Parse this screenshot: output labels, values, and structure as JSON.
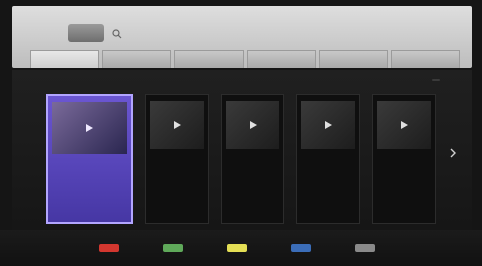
{
  "header": {
    "logo": "",
    "title": "",
    "tabs": [
      {
        "label": "",
        "active": true
      },
      {
        "label": "",
        "active": false
      },
      {
        "label": "",
        "active": false
      },
      {
        "label": "",
        "active": false
      },
      {
        "label": "",
        "active": false
      },
      {
        "label": "",
        "active": false
      }
    ]
  },
  "main": {
    "section_title": "",
    "page_indicator": "",
    "cards": [
      {
        "title": "",
        "description": "",
        "selected": true
      },
      {
        "title": "",
        "description": "",
        "selected": false
      },
      {
        "title": "",
        "description": "",
        "selected": false
      },
      {
        "title": "",
        "description": "",
        "selected": false
      },
      {
        "title": "",
        "description": "",
        "selected": false
      }
    ]
  },
  "footer": {
    "keys": [
      {
        "color": "#d3372f",
        "label": ""
      },
      {
        "color": "#5fa95a",
        "label": ""
      },
      {
        "color": "#e4df55",
        "label": ""
      },
      {
        "color": "#3b6db8",
        "label": ""
      },
      {
        "color": "#8a8a8a",
        "label": ""
      }
    ]
  },
  "icons": {
    "search": "search-icon",
    "play": "play-icon",
    "scroll_right": "chevron-right-icon"
  }
}
